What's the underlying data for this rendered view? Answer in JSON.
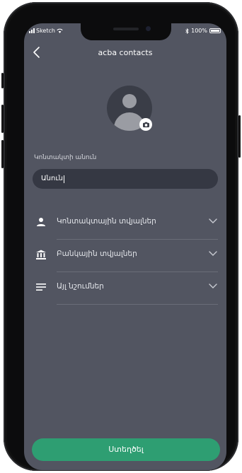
{
  "status_bar": {
    "carrier": "Sketch",
    "battery": "100%"
  },
  "nav": {
    "title": "acba contacts"
  },
  "form": {
    "name_label": "Կոնտակտի անուն",
    "name_value": "Անուն"
  },
  "sections": [
    {
      "label": "Կոնտակտային տվյալներ",
      "icon": "person-icon"
    },
    {
      "label": "Բանկային տվյալներ",
      "icon": "bank-icon"
    },
    {
      "label": "Այլ նշումներ",
      "icon": "notes-icon"
    }
  ],
  "actions": {
    "save_label": "Ստեղծել"
  },
  "colors": {
    "screen_bg": "#525561",
    "input_bg": "#353843",
    "accent": "#2e9e72"
  }
}
